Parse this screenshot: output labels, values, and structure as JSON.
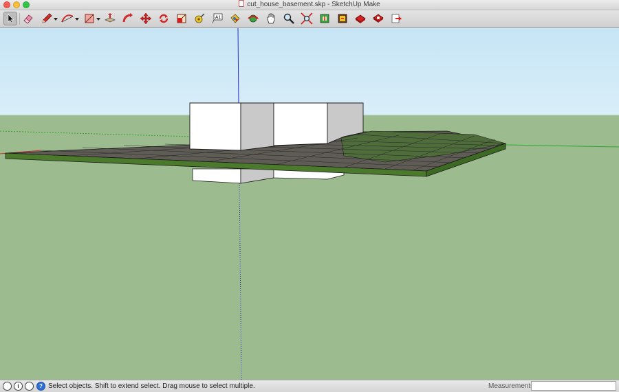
{
  "window": {
    "title": "cut_house_basement.skp - SketchUp Make"
  },
  "toolbar": {
    "tools": [
      {
        "id": "select",
        "icon": "select-arrow-icon"
      },
      {
        "id": "eraser",
        "icon": "eraser-icon"
      },
      {
        "id": "line",
        "icon": "pencil-icon"
      },
      {
        "id": "arc",
        "icon": "arc-icon"
      },
      {
        "id": "rectangle",
        "icon": "rectangle-icon"
      },
      {
        "id": "push-pull",
        "icon": "push-pull-icon"
      },
      {
        "id": "offset",
        "icon": "follow-me-icon"
      },
      {
        "id": "move",
        "icon": "move-icon"
      },
      {
        "id": "rotate",
        "icon": "rotate-icon"
      },
      {
        "id": "scale",
        "icon": "scale-icon"
      },
      {
        "id": "tape-measure",
        "icon": "tape-measure-icon"
      },
      {
        "id": "text",
        "icon": "text-icon"
      },
      {
        "id": "paint-bucket",
        "icon": "paint-bucket-icon"
      },
      {
        "id": "orbit",
        "icon": "orbit-icon"
      },
      {
        "id": "pan",
        "icon": "pan-hand-icon"
      },
      {
        "id": "zoom",
        "icon": "zoom-icon"
      },
      {
        "id": "zoom-extents",
        "icon": "zoom-extents-icon"
      },
      {
        "id": "get-models",
        "icon": "get-models-icon"
      },
      {
        "id": "share-model",
        "icon": "share-model-icon"
      },
      {
        "id": "warehouse",
        "icon": "warehouse-icon"
      },
      {
        "id": "extension",
        "icon": "extension-warehouse-icon"
      },
      {
        "id": "layout",
        "icon": "send-to-layout-icon"
      }
    ],
    "text_tool_label": "A1"
  },
  "status": {
    "hint": "Select objects. Shift to extend select. Drag mouse to select multiple.",
    "help_glyph": "?",
    "info_glyph": "i"
  },
  "measurements": {
    "label": "Measurements",
    "value": ""
  },
  "colors": {
    "sky": "#c6e5f6",
    "ground": "#9cbb8e",
    "terrain_top": "#5a7a3a",
    "terrain_edge": "#4c7a2c",
    "house": "#ffffff",
    "house_shadow": "#c9c9c9",
    "axis_red": "#d42a2a",
    "axis_green": "#2ea82e",
    "axis_blue": "#2a2ad4"
  }
}
